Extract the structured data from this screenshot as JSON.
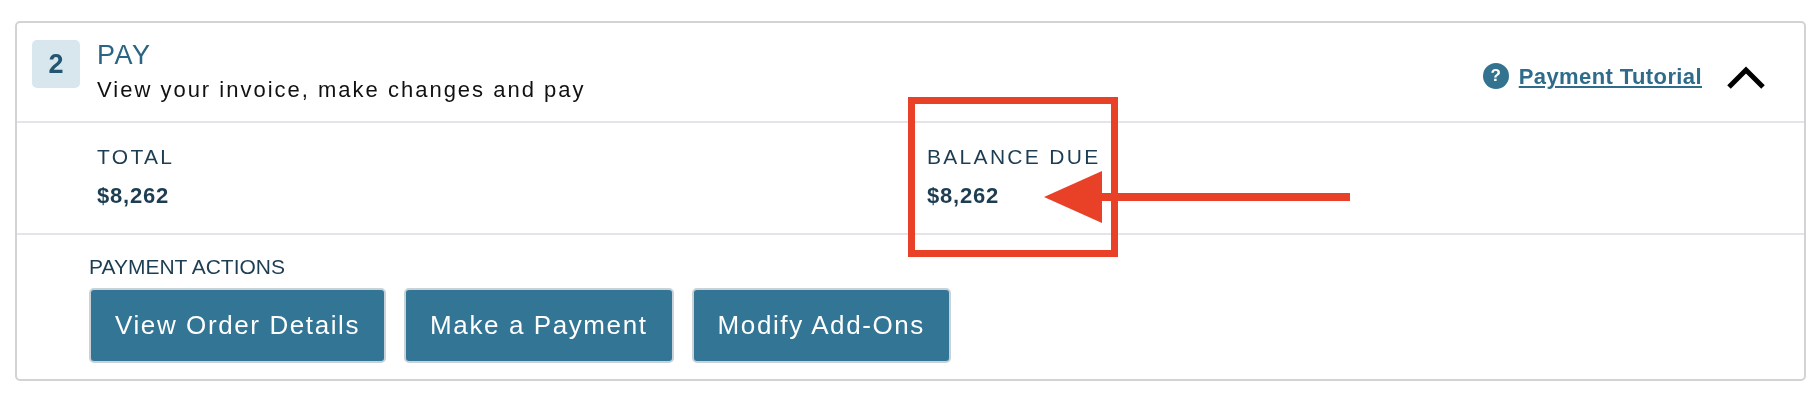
{
  "section": {
    "step": "2",
    "title": "PAY",
    "subtitle": "View your invoice, make changes and pay",
    "help_icon": "?",
    "help_link": "Payment Tutorial",
    "expanded": true
  },
  "summary": [
    {
      "label": "TOTAL",
      "amount": "$8,262",
      "highlighted": false
    },
    {
      "label": "BALANCE DUE",
      "amount": "$8,262",
      "highlighted": true
    }
  ],
  "actions": {
    "label": "PAYMENT ACTIONS",
    "buttons": [
      "View Order Details",
      "Make a Payment",
      "Modify Add-Ons"
    ]
  }
}
